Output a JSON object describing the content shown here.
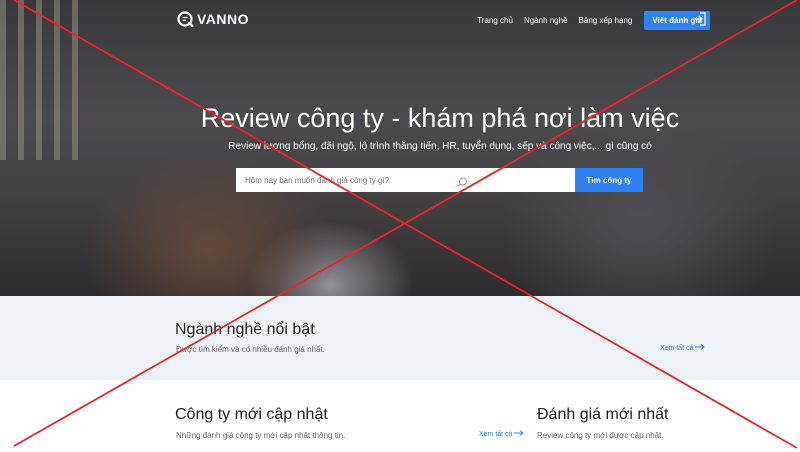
{
  "brand": {
    "name": "VANNO"
  },
  "nav": {
    "links": [
      "Trang chủ",
      "Ngành nghề",
      "Bảng xếp hạng"
    ],
    "cta": "Viết đánh giá"
  },
  "hero": {
    "title": "Review công ty - khám phá nơi làm việc",
    "subtitle": "Review lương bổng, đãi ngộ, lộ trình thăng tiến, HR, tuyển dụng, sếp và công việc,... gì cũng có",
    "search_placeholder": "Hôm nay bạn muốn đánh giá công ty gì?",
    "search_button": "Tìm công ty"
  },
  "industries": {
    "heading": "Ngành nghề nổi bật",
    "desc": "Được tìm kiếm và có nhiều đánh giá nhất.",
    "see_all": "Xem tất cả"
  },
  "companies": {
    "heading": "Công ty mới cập nhật",
    "desc": "Những đánh giá công ty mới cập nhật thông tin.",
    "see_all": "Xem tất cả"
  },
  "reviews": {
    "heading": "Đánh giá mới nhất",
    "desc": "Review công ty mới được cập nhật."
  },
  "colors": {
    "accent": "#2f82f2",
    "cross": "#e8232a",
    "section_bg": "#eef2f6"
  }
}
